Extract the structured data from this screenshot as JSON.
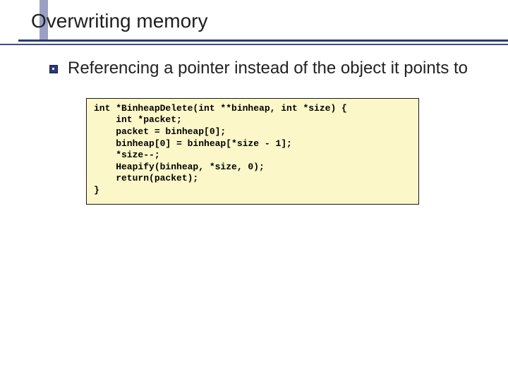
{
  "slide": {
    "title": "Overwriting memory",
    "bullets": [
      {
        "text": "Referencing a pointer instead of the object it points to"
      }
    ],
    "code": "int *BinheapDelete(int **binheap, int *size) {\n    int *packet;\n    packet = binheap[0];\n    binheap[0] = binheap[*size - 1];\n    *size--;\n    Heapify(binheap, *size, 0);\n    return(packet);\n}"
  }
}
